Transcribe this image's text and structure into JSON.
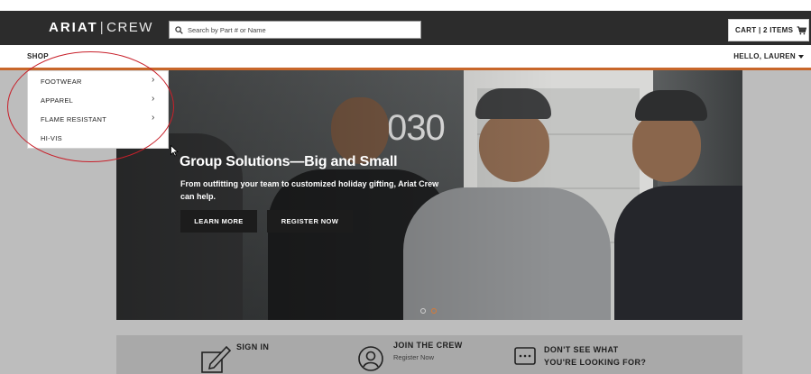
{
  "header": {
    "logo_brand": "ARIAT",
    "logo_separator": "|",
    "logo_product": "CREW",
    "search_placeholder": "Search by Part # or Name",
    "cart_label": "CART | 2 ITEMS"
  },
  "nav": {
    "shop_label": "SHOP",
    "greeting": "HELLO, LAUREN"
  },
  "dropdown": {
    "items": [
      {
        "label": "FOOTWEAR",
        "has_submenu": true
      },
      {
        "label": "APPAREL",
        "has_submenu": true
      },
      {
        "label": "FLAME RESISTANT",
        "has_submenu": true
      },
      {
        "label": "HI-VIS",
        "has_submenu": false
      }
    ],
    "chevron": "›"
  },
  "hero": {
    "house_number": "030",
    "title": "Group Solutions—Big and Small",
    "subtitle": "From outfitting your team to customized holiday gifting, Ariat Crew can help.",
    "learn_more": "LEARN MORE",
    "register_now": "REGISTER NOW",
    "slides": 2,
    "active_slide": 2
  },
  "bottom": {
    "sign_in_title": "SIGN IN",
    "join_title": "JOIN THE CREW",
    "join_sub": "Register Now",
    "dont_see_title_line1": "DON'T SEE WHAT",
    "dont_see_title_line2": "YOU'RE LOOKING FOR?"
  },
  "colors": {
    "accent": "#c8662a",
    "header_bg": "#2c2c2c",
    "annotation_ellipse": "#c8202a"
  }
}
